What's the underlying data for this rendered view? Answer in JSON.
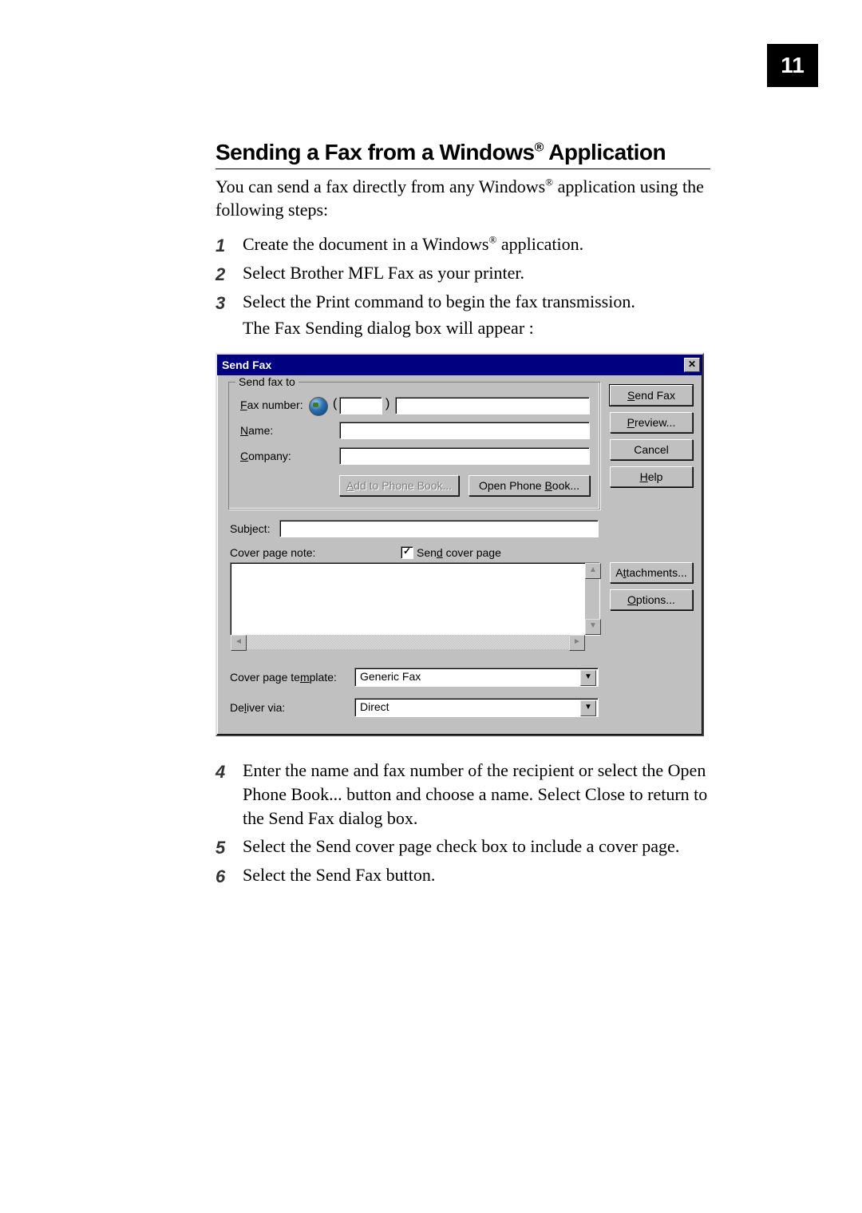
{
  "page_number": "11",
  "heading": "Sending a Fax from a Windows® Application",
  "intro": "You can send a fax directly from any Windows® application using the following steps:",
  "steps_top": [
    "Create the document in a Windows® application.",
    "Select Brother MFL Fax as your printer.",
    "Select the Print command to begin the fax transmission."
  ],
  "step3_sub": "The Fax Sending dialog box will appear :",
  "dialog": {
    "title": "Send Fax",
    "close_glyph": "✕",
    "group_legend": "Send fax to",
    "labels": {
      "fax_number": "Fax number:",
      "name": "Name:",
      "company": "Company:",
      "subject": "Subject:",
      "cover_note": "Cover page note:",
      "send_cover": "Send cover page",
      "cover_template": "Cover page template:",
      "deliver_via": "Deliver via:"
    },
    "underline_letters": {
      "fax_number": "F",
      "name": "N",
      "company": "C",
      "send_cover": "d",
      "cover_template": "m",
      "deliver_via": "l",
      "send_fax_btn": "S",
      "preview_btn": "P",
      "help_btn": "H",
      "attachments_btn": "t",
      "options_btn": "O",
      "add_phone_btn": "A",
      "open_phone_btn": "B"
    },
    "buttons": {
      "send_fax": "Send Fax",
      "preview": "Preview...",
      "cancel": "Cancel",
      "help": "Help",
      "attachments": "Attachments...",
      "options": "Options...",
      "add_phonebook": "Add to Phone Book...",
      "open_phonebook": "Open Phone Book..."
    },
    "values": {
      "fax_area": "",
      "fax_number": "",
      "name": "",
      "company": "",
      "subject": "",
      "cover_note": "",
      "send_cover_checked": "✓",
      "cover_template": "Generic Fax",
      "deliver_via": "Direct"
    },
    "parens": {
      "open": "(",
      "close": ")"
    }
  },
  "steps_bottom": [
    "Enter the name and fax number of the recipient or select the Open Phone Book... button and choose a name.  Select Close to return to the Send Fax dialog box.",
    "Select the Send cover page check box to include a cover page.",
    "Select the Send Fax button."
  ]
}
